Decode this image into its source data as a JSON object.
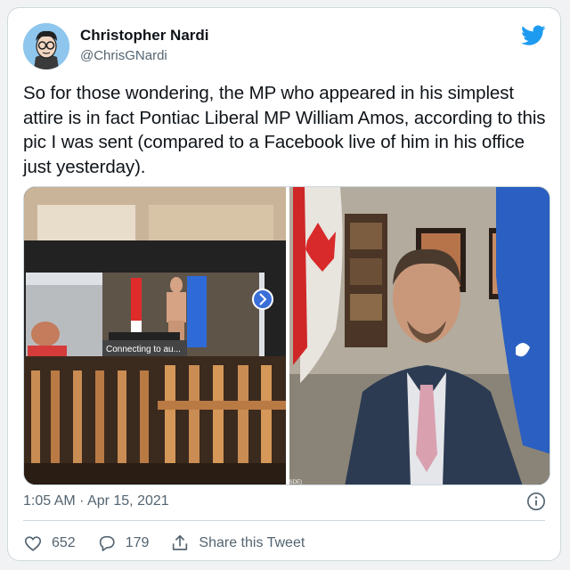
{
  "author": {
    "name": "Christopher Nardi",
    "handle": "@ChrisGNardi"
  },
  "tweet": {
    "text": "So for those wondering, the MP who appeared in his simplest attire is in fact Pontiac Liberal MP William Amos, according to this pic I was sent (compared to a Facebook live of him in his office just yesterday).",
    "timestamp": "1:05 AM · Apr 15, 2021"
  },
  "media": {
    "left_overlay_text": "Connecting to au...",
    "right_corner_text": "ISDE)"
  },
  "actions": {
    "likes": "652",
    "replies": "179",
    "share_label": "Share this Tweet"
  },
  "colors": {
    "brand": "#1d9bf0",
    "muted": "#536471",
    "border": "#cfd9de"
  },
  "icons": [
    "twitter-bird-icon",
    "info-icon",
    "heart-icon",
    "reply-icon",
    "share-icon"
  ]
}
